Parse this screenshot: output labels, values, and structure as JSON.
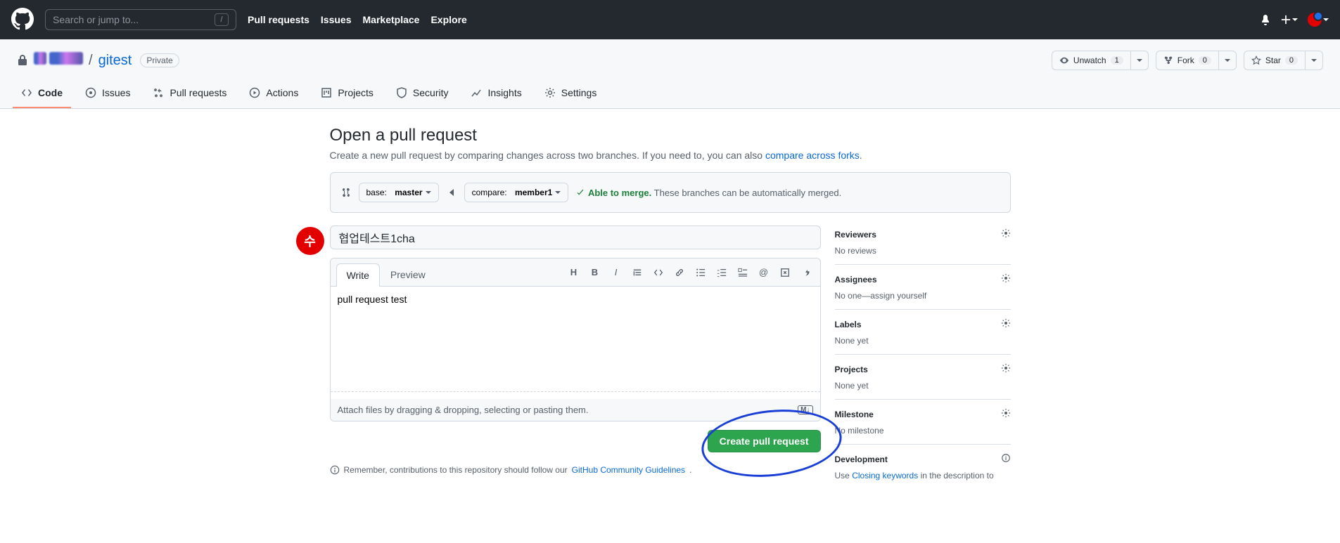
{
  "header": {
    "search_placeholder": "Search or jump to...",
    "slash": "/",
    "nav": {
      "pull_requests": "Pull requests",
      "issues": "Issues",
      "marketplace": "Marketplace",
      "explore": "Explore"
    }
  },
  "repo": {
    "name": "gitest",
    "visibility": "Private",
    "actions": {
      "unwatch": "Unwatch",
      "unwatch_count": "1",
      "fork": "Fork",
      "fork_count": "0",
      "star": "Star",
      "star_count": "0"
    },
    "tabs": {
      "code": "Code",
      "issues": "Issues",
      "pull_requests": "Pull requests",
      "actions": "Actions",
      "projects": "Projects",
      "security": "Security",
      "insights": "Insights",
      "settings": "Settings"
    }
  },
  "page": {
    "title": "Open a pull request",
    "subtitle_prefix": "Create a new pull request by comparing changes across two branches. If you need to, you can also ",
    "subtitle_link": "compare across forks",
    "subtitle_suffix": ".",
    "compare": {
      "base_label": "base:",
      "base_branch": "master",
      "compare_label": "compare:",
      "compare_branch": "member1",
      "able": "Able to merge.",
      "able_rest": "These branches can be automatically merged."
    },
    "form": {
      "title_value": "협업테스트1cha",
      "write_tab": "Write",
      "preview_tab": "Preview",
      "body_value": "pull request test",
      "attach_text": "Attach files by dragging & dropping, selecting or pasting them.",
      "md_badge": "M↓",
      "submit": "Create pull request"
    },
    "remember_prefix": "Remember, contributions to this repository should follow our ",
    "remember_link": "GitHub Community Guidelines",
    "remember_suffix": "."
  },
  "sidebar": {
    "reviewers": {
      "title": "Reviewers",
      "body": "No reviews"
    },
    "assignees": {
      "title": "Assignees",
      "body_prefix": "No one—",
      "assign_self": "assign yourself"
    },
    "labels": {
      "title": "Labels",
      "body": "None yet"
    },
    "projects": {
      "title": "Projects",
      "body": "None yet"
    },
    "milestone": {
      "title": "Milestone",
      "body": "No milestone"
    },
    "development": {
      "title": "Development",
      "body_prefix": "Use ",
      "body_link": "Closing keywords",
      "body_suffix": " in the description to"
    }
  }
}
